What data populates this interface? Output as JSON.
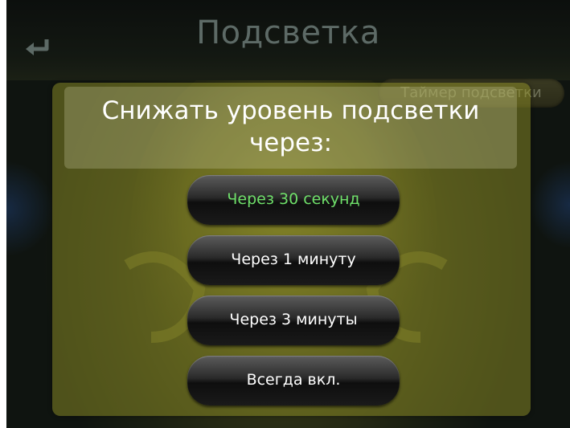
{
  "header": {
    "title": "Подсветка",
    "back_icon": "back-arrow-icon"
  },
  "tabs": {
    "timer_label": "Таймер подсветки"
  },
  "dialog": {
    "prompt": "Снижать уровень подсветки через:",
    "options": [
      {
        "label": "Через 30 секунд",
        "selected": true
      },
      {
        "label": "Через 1 минуту",
        "selected": false
      },
      {
        "label": "Через 3 минуты",
        "selected": false
      },
      {
        "label": "Всегда вкл.",
        "selected": false
      }
    ]
  },
  "colors": {
    "selected_text": "#6fe06a",
    "title_text": "#5d6a66"
  }
}
